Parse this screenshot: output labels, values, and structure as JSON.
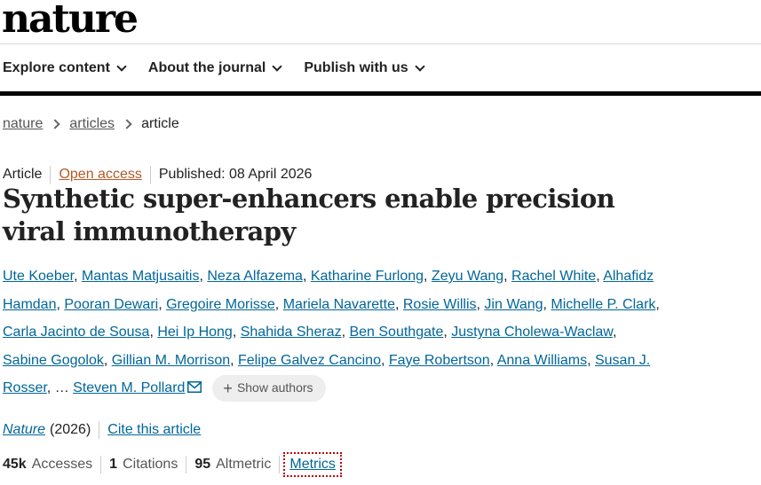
{
  "header": {
    "logo": "nature",
    "nav": [
      {
        "label": "Explore content"
      },
      {
        "label": "About the journal"
      },
      {
        "label": "Publish with us"
      }
    ]
  },
  "breadcrumb": [
    "nature",
    "articles",
    "article"
  ],
  "article": {
    "type": "Article",
    "access": "Open access",
    "published": "Published: 08 April 2026",
    "title": "Synthetic super-enhancers enable precision viral immunotherapy",
    "authors": [
      "Ute Koeber",
      "Mantas Matjusaitis",
      "Neza Alfazema",
      "Katharine Furlong",
      "Zeyu Wang",
      "Rachel White",
      "Alhafidz Hamdan",
      "Pooran Dewari",
      "Gregoire Morisse",
      "Mariela Navarette",
      "Rosie Willis",
      "Jin Wang",
      "Michelle P. Clark",
      "Carla Jacinto de Sousa",
      "Hei Ip Hong",
      "Shahida Sheraz",
      "Ben Southgate",
      "Justyna Cholewa-Waclaw",
      "Sabine Gogolok",
      "Gillian M. Morrison",
      "Felipe Galvez Cancino",
      "Faye Robertson",
      "Anna Williams",
      "Susan J. Rosser"
    ],
    "ellipsis": "…",
    "last_author": "Steven M. Pollard",
    "show_authors": "Show authors",
    "journal": "Nature",
    "year": "(2026)",
    "cite": "Cite this article",
    "metrics": {
      "accesses_value": "45k",
      "accesses_label": "Accesses",
      "citations_value": "1",
      "citations_label": "Citations",
      "altmetric_value": "95",
      "altmetric_label": "Altmetric",
      "link": "Metrics"
    }
  }
}
